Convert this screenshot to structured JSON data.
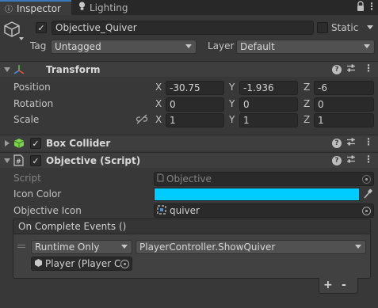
{
  "tabs": {
    "inspector": {
      "label": "Inspector",
      "icon": "info-icon"
    },
    "lighting": {
      "label": "Lighting",
      "icon": "lightbulb-icon"
    }
  },
  "gameobject": {
    "name": "Objective_Quiver",
    "active": true,
    "static_label": "Static",
    "static": false,
    "tag_label": "Tag",
    "tag": "Untagged",
    "layer_label": "Layer",
    "layer": "Default"
  },
  "transform": {
    "title": "Transform",
    "position": {
      "label": "Position",
      "x": "-30.75",
      "y": "-1.936",
      "z": "-6"
    },
    "rotation": {
      "label": "Rotation",
      "x": "0",
      "y": "0",
      "z": "0"
    },
    "scale": {
      "label": "Scale",
      "x": "1",
      "y": "1",
      "z": "1"
    },
    "axes": {
      "x": "X",
      "y": "Y",
      "z": "Z"
    }
  },
  "box_collider": {
    "title": "Box Collider",
    "enabled": true
  },
  "objective_script": {
    "title": "Objective (Script)",
    "enabled": true,
    "script_label": "Script",
    "script_value": "Objective",
    "icon_color_label": "Icon Color",
    "icon_color": "#00ccff",
    "objective_icon_label": "Objective Icon",
    "objective_icon_value": "quiver",
    "event": {
      "title": "On Complete Events ()",
      "runtime_mode": "Runtime Only",
      "function": "PlayerController.ShowQuiver",
      "target": "Player (Player C",
      "add_label": "+",
      "remove_label": "-"
    }
  },
  "colors": {
    "accent": "#3a79bb",
    "background": "#383838",
    "header": "#3e3e3e"
  }
}
